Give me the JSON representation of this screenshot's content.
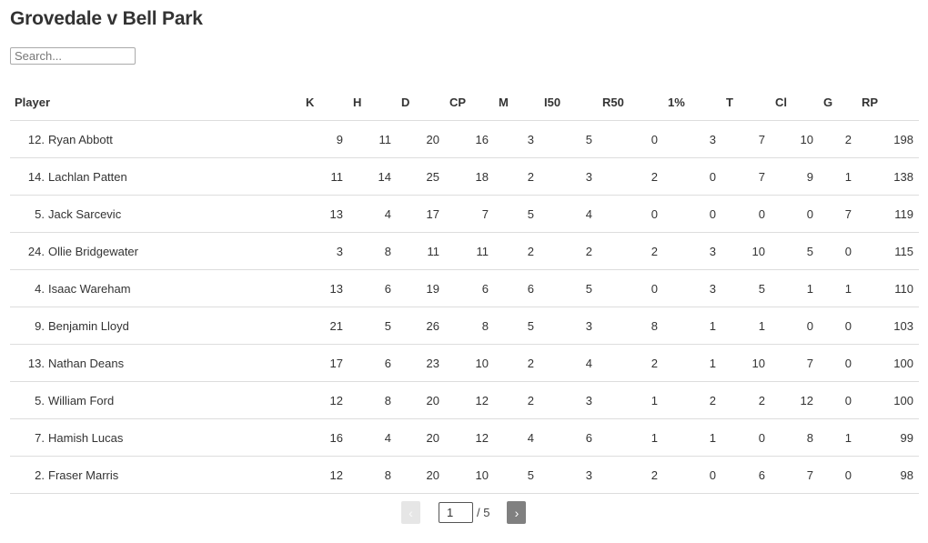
{
  "title": "Grovedale v Bell Park",
  "search": {
    "placeholder": "Search...",
    "value": ""
  },
  "table": {
    "headers": [
      "Player",
      "K",
      "H",
      "D",
      "CP",
      "M",
      "I50",
      "R50",
      "1%",
      "T",
      "Cl",
      "G",
      "RP"
    ],
    "rows": [
      {
        "num": "12.",
        "name": "Ryan Abbott",
        "stats": [
          "9",
          "11",
          "20",
          "16",
          "3",
          "5",
          "0",
          "3",
          "7",
          "10",
          "2",
          "198"
        ]
      },
      {
        "num": "14.",
        "name": "Lachlan Patten",
        "stats": [
          "11",
          "14",
          "25",
          "18",
          "2",
          "3",
          "2",
          "0",
          "7",
          "9",
          "1",
          "138"
        ]
      },
      {
        "num": "5.",
        "name": "Jack Sarcevic",
        "stats": [
          "13",
          "4",
          "17",
          "7",
          "5",
          "4",
          "0",
          "0",
          "0",
          "0",
          "7",
          "119"
        ]
      },
      {
        "num": "24.",
        "name": "Ollie Bridgewater",
        "stats": [
          "3",
          "8",
          "11",
          "11",
          "2",
          "2",
          "2",
          "3",
          "10",
          "5",
          "0",
          "115"
        ]
      },
      {
        "num": "4.",
        "name": "Isaac Wareham",
        "stats": [
          "13",
          "6",
          "19",
          "6",
          "6",
          "5",
          "0",
          "3",
          "5",
          "1",
          "1",
          "110"
        ]
      },
      {
        "num": "9.",
        "name": "Benjamin Lloyd",
        "stats": [
          "21",
          "5",
          "26",
          "8",
          "5",
          "3",
          "8",
          "1",
          "1",
          "0",
          "0",
          "103"
        ]
      },
      {
        "num": "13.",
        "name": "Nathan Deans",
        "stats": [
          "17",
          "6",
          "23",
          "10",
          "2",
          "4",
          "2",
          "1",
          "10",
          "7",
          "0",
          "100"
        ]
      },
      {
        "num": "5.",
        "name": "William Ford",
        "stats": [
          "12",
          "8",
          "20",
          "12",
          "2",
          "3",
          "1",
          "2",
          "2",
          "12",
          "0",
          "100"
        ]
      },
      {
        "num": "7.",
        "name": "Hamish Lucas",
        "stats": [
          "16",
          "4",
          "20",
          "12",
          "4",
          "6",
          "1",
          "1",
          "0",
          "8",
          "1",
          "99"
        ]
      },
      {
        "num": "2.",
        "name": "Fraser Marris",
        "stats": [
          "12",
          "8",
          "20",
          "10",
          "5",
          "3",
          "2",
          "0",
          "6",
          "7",
          "0",
          "98"
        ]
      }
    ]
  },
  "pagination": {
    "prev_icon": "‹",
    "next_icon": "›",
    "current_page": "1",
    "total_label": "/ 5"
  }
}
